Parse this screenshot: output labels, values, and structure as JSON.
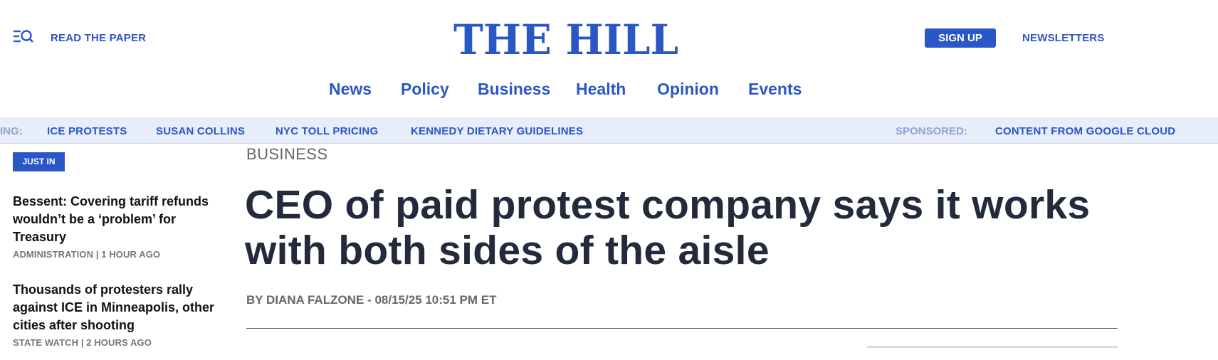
{
  "header": {
    "menu_icon": "menu-search-icon",
    "read_paper": "READ THE PAPER",
    "logo_text": "THE HILL",
    "signup": "SIGN UP",
    "newsletters": "NEWSLETTERS"
  },
  "nav": {
    "items": [
      "News",
      "Policy",
      "Business",
      "Health",
      "Opinion",
      "Events"
    ]
  },
  "trending": {
    "label": "ING:",
    "links": [
      "ICE PROTESTS",
      "SUSAN COLLINS",
      "NYC TOLL PRICING",
      "KENNEDY DIETARY GUIDELINES"
    ],
    "sponsored_label": "SPONSORED:",
    "sponsored_link": "CONTENT FROM GOOGLE CLOUD"
  },
  "just_in": {
    "badge": "JUST IN",
    "items": [
      {
        "headline": "Bessent: Covering tariff refunds wouldn’t be a ‘problem’ for Treasury",
        "category": "ADMINISTRATION",
        "time": "1 HOUR AGO"
      },
      {
        "headline": "Thousands of protesters rally against ICE in Minneapolis, other cities after shooting",
        "category": "STATE WATCH",
        "time": "2 HOURS AGO"
      }
    ]
  },
  "article": {
    "section": "BUSINESS",
    "title": "CEO of paid protest company says it works with both sides of the aisle",
    "byline_prefix": "BY",
    "author": "DIANA FALZONE",
    "datetime": "08/15/25 10:51 PM ET"
  },
  "colors": {
    "brand_blue": "#2a56c6",
    "title": "#222a3b",
    "trending_bg": "#e7eef9"
  }
}
